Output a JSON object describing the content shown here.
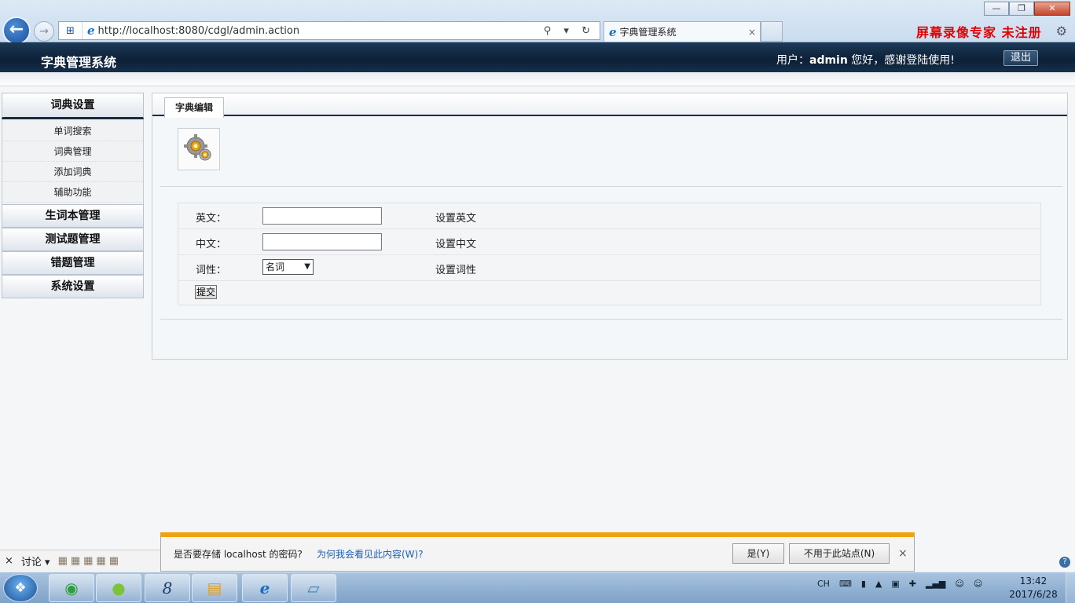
{
  "browser": {
    "url": "http://localhost:8080/cdgl/admin.action",
    "tab_title": "字典管理系统",
    "tab_close": "×",
    "watermark": "屏幕录像专家  未注册",
    "win_minimize": "—",
    "win_restore": "❐",
    "win_close": "✕",
    "back": "←",
    "forward": "→",
    "address_tools": "⚲ ▾ ↻"
  },
  "header": {
    "app_title": "字典管理系统",
    "welcome_prefix": "用户：",
    "username": "admin",
    "welcome_suffix": " 您好，感谢登陆使用!",
    "logout_label": "退出"
  },
  "sidebar": {
    "sections": [
      {
        "label": "词典设置",
        "items": [
          "单词搜索",
          "词典管理",
          "添加词典",
          "辅助功能"
        ]
      },
      {
        "label": "生词本管理"
      },
      {
        "label": "测试题管理"
      },
      {
        "label": "错题管理"
      },
      {
        "label": "系统设置"
      }
    ]
  },
  "main": {
    "tab_label": "字典编辑",
    "form": {
      "english_label": "英文：",
      "english_value": "",
      "english_hint": "设置英文",
      "chinese_label": "中文：",
      "chinese_value": "",
      "chinese_hint": "设置中文",
      "pos_label": "词性：",
      "pos_selected": "名词",
      "pos_hint": "设置词性",
      "submit_label": "提交"
    }
  },
  "password_bar": {
    "question": "是否要存储 localhost 的密码?",
    "why_link": "为何我会看见此内容(W)?",
    "yes_label": "是(Y)",
    "no_label": "不用于此站点(N)",
    "close": "×"
  },
  "bottom_strip": {
    "close": "×",
    "discuss_label": "讨论 ▾"
  },
  "taskbar": {
    "tray_lang": "CH",
    "time": "13:42",
    "date": "2017/6/28"
  }
}
